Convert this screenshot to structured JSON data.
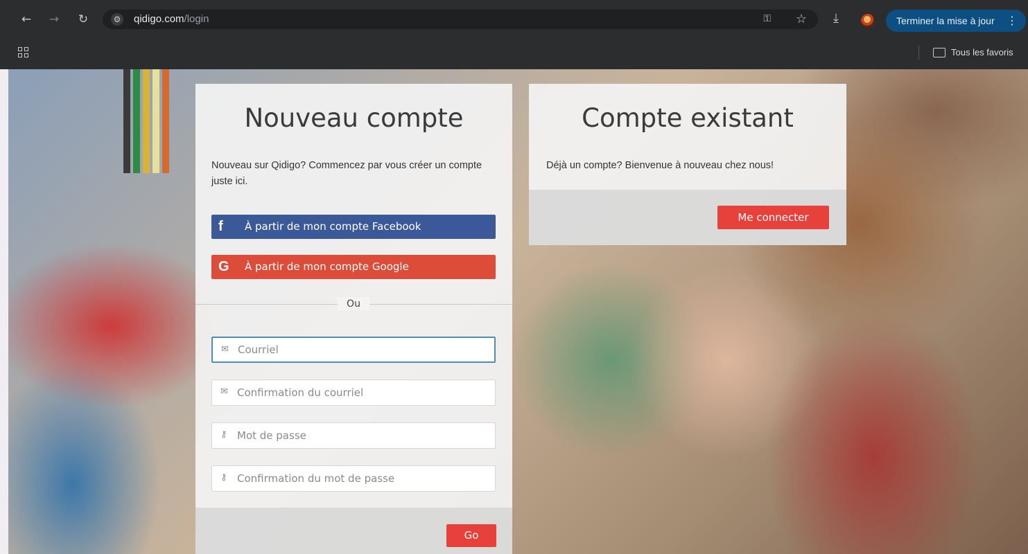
{
  "browser": {
    "url_host": "qidigo.com",
    "url_path": "/login",
    "update_button": "Terminer la mise à jour",
    "bookmarks_folder": "Tous les favoris",
    "icons": [
      "back-icon",
      "forward-icon",
      "reload-icon",
      "site-settings-icon",
      "password-key-icon",
      "bookmark-star-icon",
      "download-icon",
      "profile-avatar",
      "menu-icon",
      "apps-icon",
      "folder-icon"
    ]
  },
  "new_account": {
    "title": "Nouveau compte",
    "intro": "Nouveau sur Qidigo? Commencez par vous créer un compte juste ici.",
    "facebook_label": "À partir de mon compte Facebook",
    "facebook_icon": "f",
    "google_label": "À partir de mon compte Google",
    "google_icon": "G",
    "divider": "Ou",
    "fields": {
      "email_placeholder": "Courriel",
      "email_confirm_placeholder": "Confirmation du courriel",
      "password_placeholder": "Mot de passe",
      "password_confirm_placeholder": "Confirmation du mot de passe"
    },
    "submit": "Go"
  },
  "existing_account": {
    "title": "Compte existant",
    "intro": "Déjà un compte? Bienvenue à nouveau chez nous!",
    "login_button": "Me connecter"
  },
  "colors": {
    "facebook": "#3b5998",
    "google": "#dd4b39",
    "accent_red": "#e8413b",
    "update_button": "#0d4f83"
  }
}
